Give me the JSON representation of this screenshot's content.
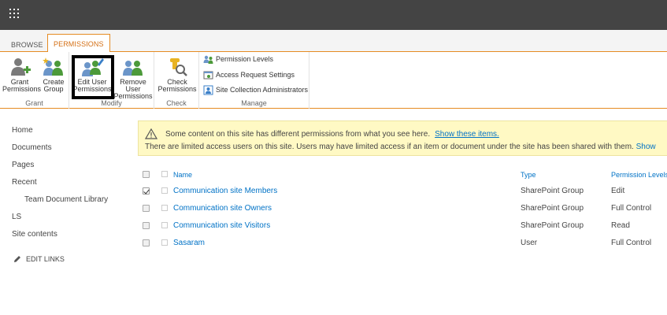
{
  "tabs": {
    "browse": "BROWSE",
    "permissions": "PERMISSIONS"
  },
  "ribbon": {
    "grant": {
      "grant_permissions": "Grant\nPermissions",
      "create_group": "Create\nGroup",
      "label": "Grant"
    },
    "modify": {
      "edit_user_permissions": "Edit User\nPermissions",
      "remove_user_permissions": "Remove User\nPermissions",
      "label": "Modify"
    },
    "check": {
      "check_permissions": "Check\nPermissions",
      "label": "Check"
    },
    "manage": {
      "permission_levels": "Permission Levels",
      "access_request_settings": "Access Request Settings",
      "site_collection_administrators": "Site Collection Administrators",
      "label": "Manage"
    }
  },
  "quicklaunch": {
    "home": "Home",
    "documents": "Documents",
    "pages": "Pages",
    "recent": "Recent",
    "team_document_library": "Team Document Library",
    "ls": "LS",
    "site_contents": "Site contents",
    "edit_links": "EDIT LINKS"
  },
  "notice": {
    "line1": "Some content on this site has different permissions from what you see here.",
    "line1_link": "Show these items.",
    "line2": "There are limited access users on this site. Users may have limited access if an item or document under the site has been shared with them.",
    "line2_link": "Show"
  },
  "table": {
    "headers": {
      "name": "Name",
      "type": "Type",
      "permission_levels": "Permission Levels"
    },
    "rows": [
      {
        "name": "Communication site Members",
        "type": "SharePoint Group",
        "permission": "Edit",
        "checked": true
      },
      {
        "name": "Communication site Owners",
        "type": "SharePoint Group",
        "permission": "Full Control",
        "checked": false
      },
      {
        "name": "Communication site Visitors",
        "type": "SharePoint Group",
        "permission": "Read",
        "checked": false
      },
      {
        "name": "Sasaram",
        "type": "User",
        "permission": "Full Control",
        "checked": false
      }
    ]
  },
  "colors": {
    "suitebar": "#444444",
    "accent": "#e58b22",
    "link": "#0072c6",
    "notice_bg": "#fff9c4"
  }
}
